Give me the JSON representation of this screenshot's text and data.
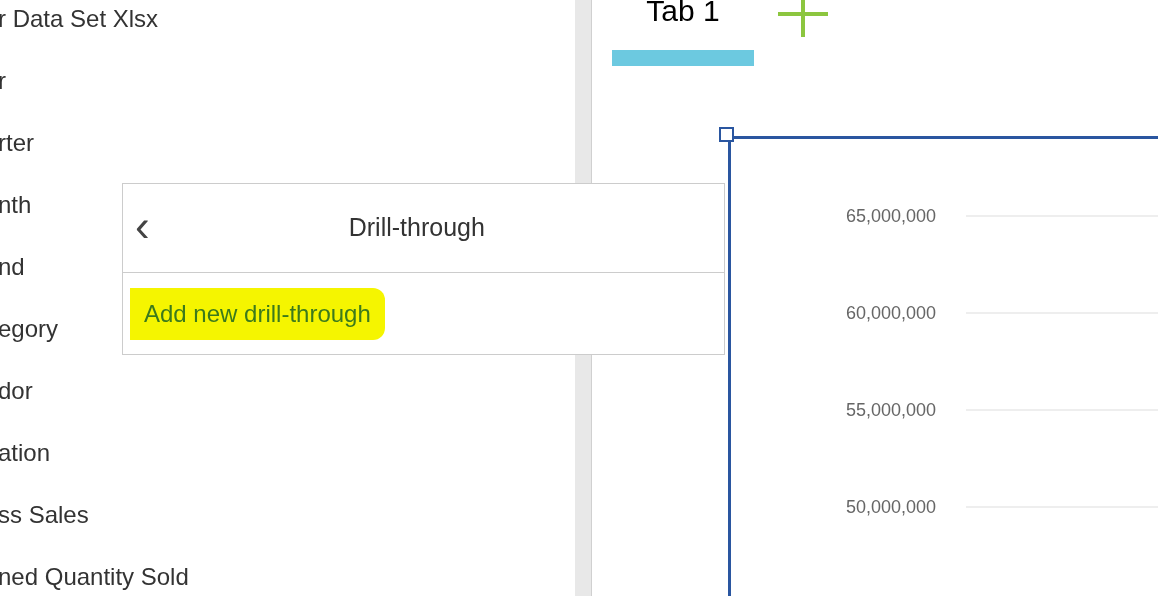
{
  "data_tree": {
    "items": [
      {
        "label": "r Data Set Xlsx"
      },
      {
        "label": "r"
      },
      {
        "label": "rter"
      },
      {
        "label": "nth"
      },
      {
        "label": "nd"
      },
      {
        "label": "egory"
      },
      {
        "label": "dor"
      },
      {
        "label": "ation"
      },
      {
        "label": "ss Sales"
      },
      {
        "label": "ned Quantity Sold"
      }
    ]
  },
  "popover": {
    "title": "Drill-through",
    "back_icon": "‹",
    "items": [
      {
        "label": "Add new drill-through",
        "highlighted": true
      }
    ]
  },
  "tabs": [
    {
      "label": "Tab 1",
      "selected": true
    }
  ],
  "chart_widget": {
    "y_axis_labels": [
      "65,000,000",
      "60,000,000",
      "55,000,000",
      "50,000,000"
    ]
  }
}
